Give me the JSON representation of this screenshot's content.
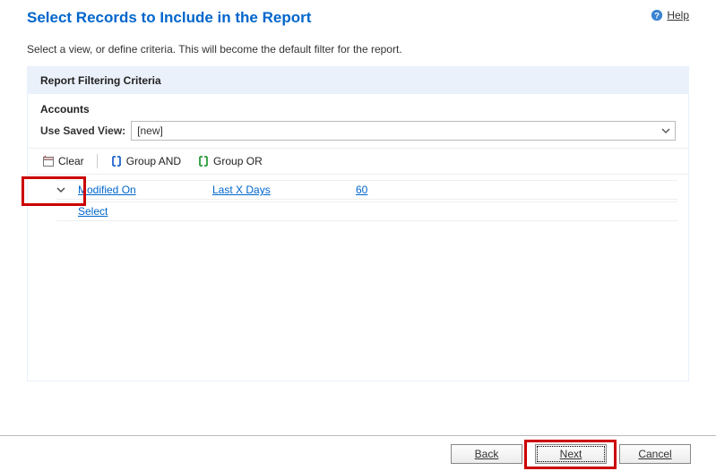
{
  "header": {
    "title": "Select Records to Include in the Report",
    "help": "Help"
  },
  "instruction": "Select a view, or define criteria. This will become the default filter for the report.",
  "panel": {
    "title": "Report Filtering Criteria",
    "section": "Accounts",
    "savedViewLabel": "Use Saved View:",
    "savedViewValue": "[new]"
  },
  "toolbar": {
    "clear": "Clear",
    "groupAnd": "Group AND",
    "groupOr": "Group OR"
  },
  "criteria": {
    "row": {
      "field": "Modified On",
      "operator": "Last X Days",
      "value": "60"
    },
    "selectPrompt": "Select"
  },
  "footer": {
    "back": "Back",
    "next": "Next",
    "cancel": "Cancel"
  }
}
